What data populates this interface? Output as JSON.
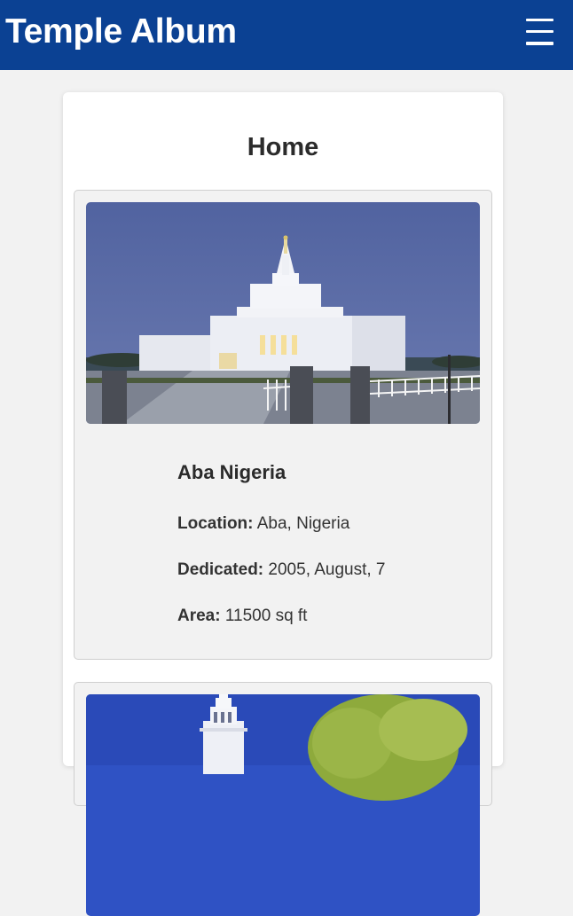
{
  "header": {
    "title": "Temple Album",
    "menu_icon": "hamburger-icon"
  },
  "main": {
    "heading": "Home",
    "temples": [
      {
        "name": "Aba Nigeria",
        "location_label": "Location:",
        "location": "Aba, Nigeria",
        "dedicated_label": "Dedicated:",
        "dedicated": "2005, August, 7",
        "area_label": "Area:",
        "area": "11500 sq ft"
      }
    ]
  },
  "colors": {
    "header_bg": "#0b4193",
    "page_bg": "#f2f2f2",
    "card_bg": "#f2f2f2"
  }
}
